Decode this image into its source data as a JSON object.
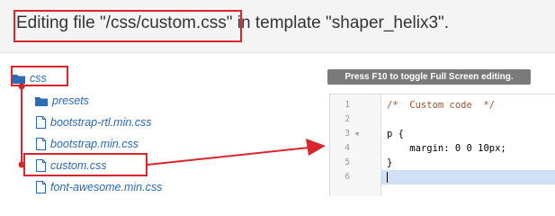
{
  "header": {
    "title": "Editing file \"/css/custom.css\" in template \"shaper_helix3\"."
  },
  "tree": {
    "items": [
      {
        "label": "css",
        "type": "folder"
      },
      {
        "label": "presets",
        "type": "folder"
      },
      {
        "label": "bootstrap-rtl.min.css",
        "type": "file"
      },
      {
        "label": "bootstrap.min.css",
        "type": "file"
      },
      {
        "label": "custom.css",
        "type": "file"
      },
      {
        "label": "font-awesome.min.css",
        "type": "file"
      }
    ]
  },
  "editor": {
    "tooltip": "Press F10 to toggle Full Screen editing.",
    "lines": [
      {
        "number": "1",
        "text": "/*  Custom code  */"
      },
      {
        "number": "2",
        "text": ""
      },
      {
        "number": "3",
        "text": "p {"
      },
      {
        "number": "4",
        "text": "    margin: 0 0 10px;"
      },
      {
        "number": "5",
        "text": "}"
      },
      {
        "number": "6",
        "text": ""
      }
    ],
    "fold_marker": "▼"
  },
  "colors": {
    "annotation": "#d9262c",
    "link": "#2a69b8",
    "comment": "#a0522d",
    "folder": "#2d6bb5"
  }
}
